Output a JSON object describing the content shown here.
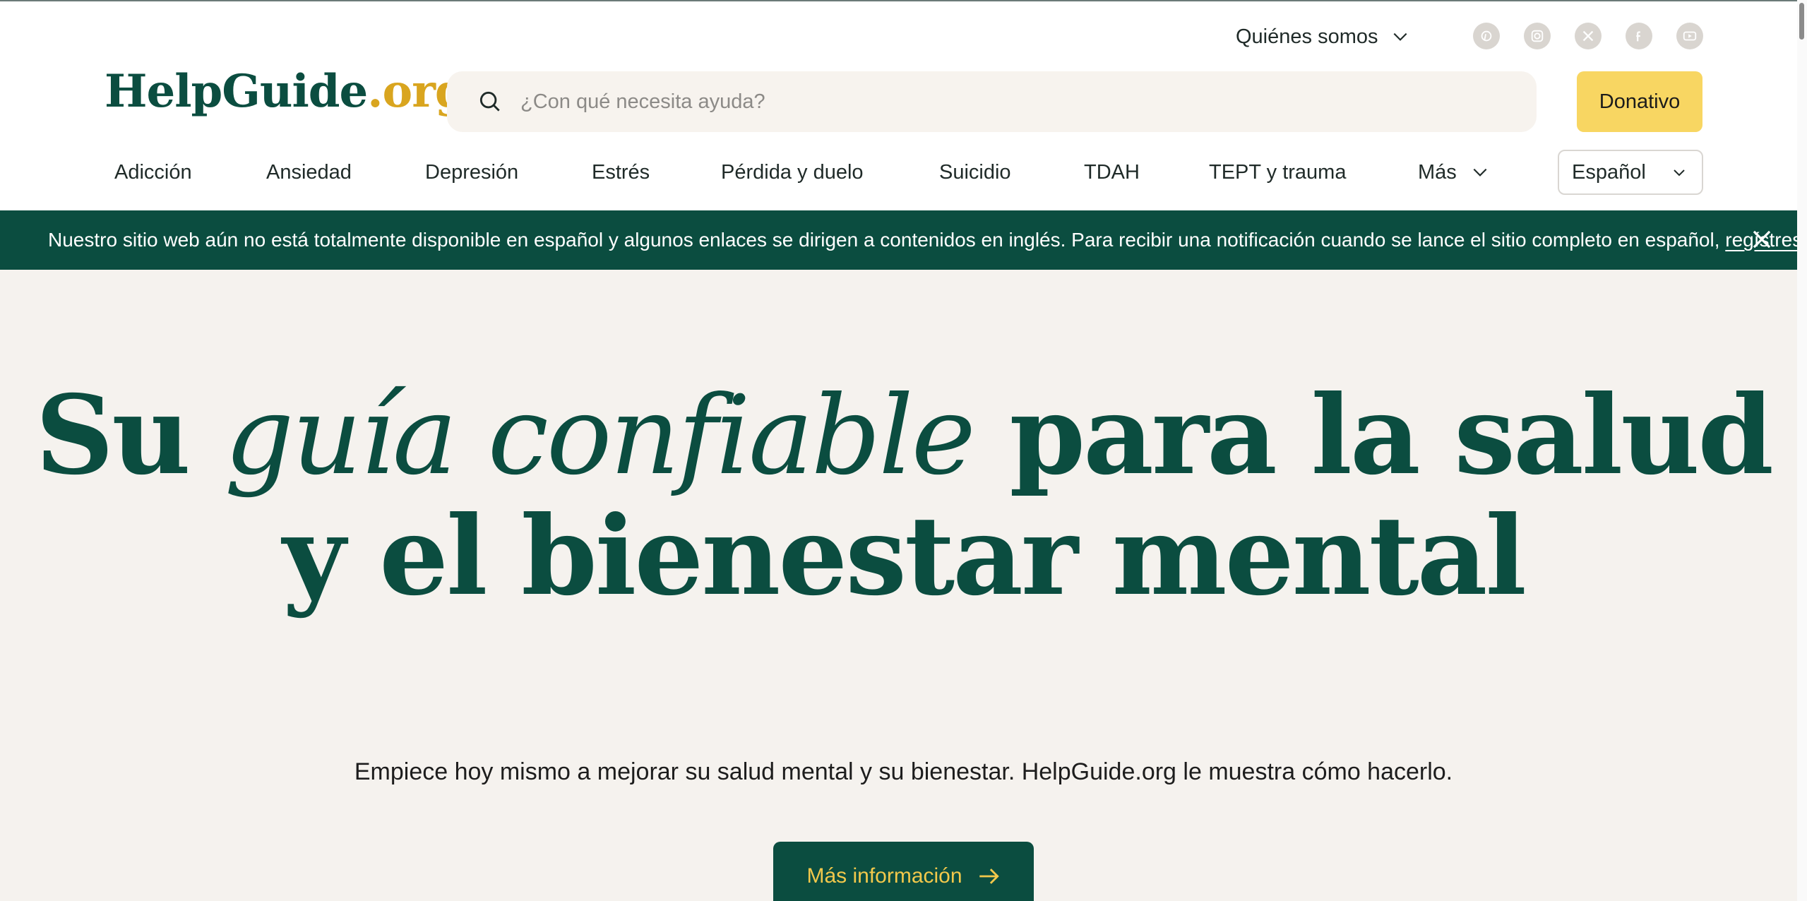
{
  "header": {
    "about_label": "Quiénes somos",
    "social": [
      "pinterest-icon",
      "instagram-icon",
      "x-icon",
      "facebook-icon",
      "youtube-icon"
    ],
    "logo": {
      "part1": "HelpGuide",
      "part2": ".org"
    },
    "search": {
      "placeholder": "¿Con qué necesita ayuda?"
    },
    "donate_label": "Donativo",
    "nav": [
      {
        "label": "Adicción"
      },
      {
        "label": "Ansiedad"
      },
      {
        "label": "Depresión"
      },
      {
        "label": "Estrés"
      },
      {
        "label": "Pérdida y duelo"
      },
      {
        "label": "Suicidio"
      },
      {
        "label": "TDAH"
      },
      {
        "label": "TEPT y trauma"
      },
      {
        "label": "Más"
      }
    ],
    "language": "Español"
  },
  "banner": {
    "text": "Nuestro sitio web aún no está totalmente disponible en español y algunos enlaces se dirigen a contenidos en inglés. Para recibir una notificación cuando se lance el sitio completo en español,",
    "link": "regístrese aquí"
  },
  "hero": {
    "title_part1": "Su",
    "title_italic": "guía confiable",
    "title_part2": "para la salud y el bienestar mental",
    "subtitle": "Empiece hoy mismo a mejorar su salud mental y su bienestar. HelpGuide.org le muestra cómo hacerlo.",
    "cta_label": "Más información"
  },
  "colors": {
    "brand_green": "#0b4d40",
    "brand_gold": "#d9a51f",
    "donate_yellow": "#f8d662",
    "hero_bg": "#f5f2ee"
  }
}
